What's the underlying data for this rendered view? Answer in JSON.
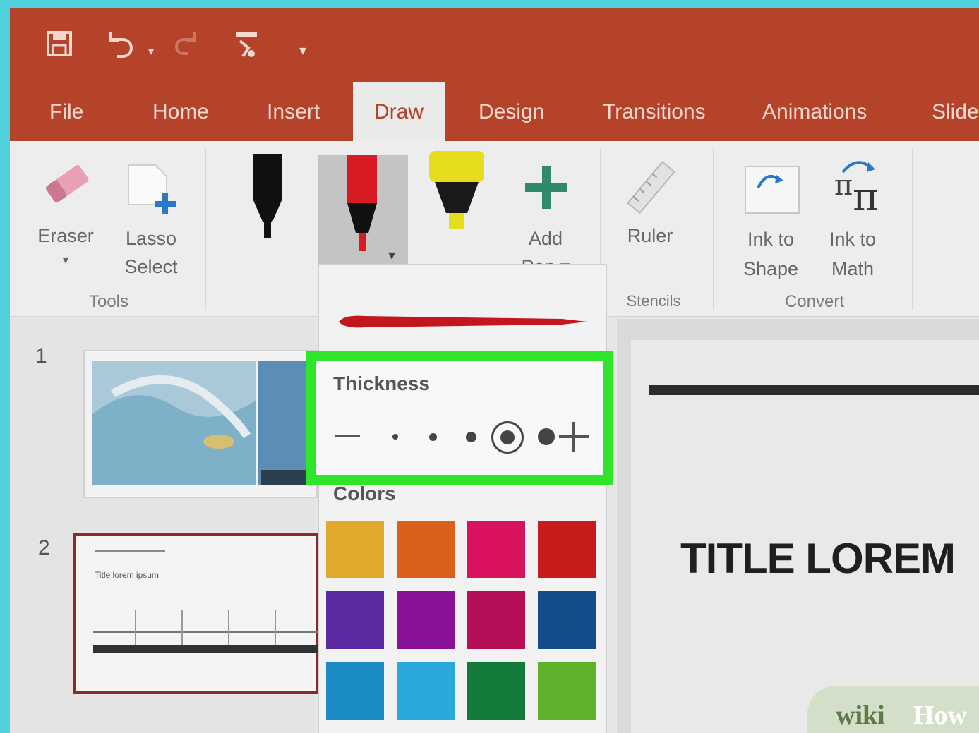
{
  "quick_access": {
    "save_icon": "save-icon",
    "undo_icon": "undo-icon",
    "redo_icon": "redo-icon",
    "touch_mode_icon": "touch-mode-icon",
    "customize_icon": "customize-icon"
  },
  "tabs": [
    {
      "label": "File"
    },
    {
      "label": "Home"
    },
    {
      "label": "Insert"
    },
    {
      "label": "Draw",
      "active": true
    },
    {
      "label": "Design"
    },
    {
      "label": "Transitions"
    },
    {
      "label": "Animations"
    },
    {
      "label": "Slide"
    }
  ],
  "ribbon": {
    "eraser_label": "Eraser",
    "eraser_arrow": "▾",
    "lasso_label": "Lasso Select",
    "tools_group": "Tools",
    "add_pen_label": "Add Pen ▾",
    "ruler_label": "Ruler",
    "stencils_group": "Stencils",
    "ink_to_shape_label": "Ink to Shape",
    "ink_to_math_label": "Ink to Math",
    "convert_group": "Convert"
  },
  "pen_panel": {
    "thickness_label": "Thickness",
    "colors_label": "Colors",
    "selected_thickness": 4,
    "thickness_levels": 5
  },
  "colors": {
    "accent": "#b5432a",
    "highlight": "#2ee52b",
    "swatches": [
      "#e2a92c",
      "#d9611c",
      "#d8125e",
      "#c81c1c",
      "#5a2aa0",
      "#8a1296",
      "#b50f58",
      "#144c8c",
      "#1b8cc4",
      "#2aa8dc",
      "#137a3a",
      "#5fb12c"
    ]
  },
  "thumbnails": {
    "slide1_number": "1",
    "slide2_number": "2",
    "slide2_caption": "Title lorem ipsum"
  },
  "slide": {
    "title": "TITLE LOREM"
  },
  "watermark": {
    "text1": "wiki",
    "text2": "How"
  }
}
